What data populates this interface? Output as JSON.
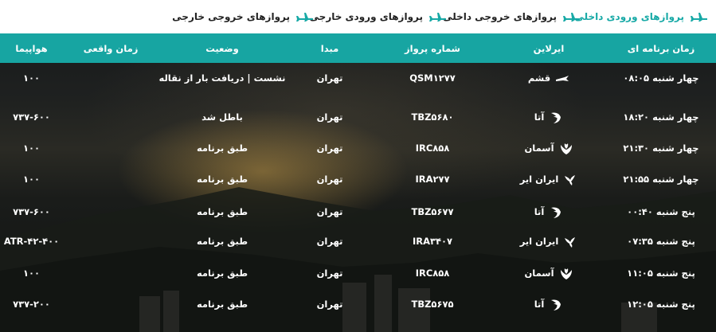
{
  "nav": {
    "items": [
      {
        "label": "پروازهای ورودی داخلی",
        "active": true
      },
      {
        "label": "پروازهای خروجی داخلی",
        "active": false
      },
      {
        "label": "پروازهای ورودی خارجی",
        "active": false
      },
      {
        "label": "پروازهای خروجی خارجی",
        "active": false
      }
    ],
    "active_color": "#17a9a6"
  },
  "table": {
    "headers": {
      "scheduled": "زمان برنامه ای",
      "airline": "ایرلاین",
      "flight": "شماره پرواز",
      "origin": "مبدا",
      "status": "وضعیت",
      "actual": "زمان واقعی",
      "aircraft": "هواپیما"
    },
    "header_color": "#17a5a2",
    "rows": [
      {
        "scheduled": "چهار شنبه ۰۸:۰۵",
        "airline": "قشم",
        "airline_icon": "qeshm-air-logo-icon",
        "flight": "QSM۱۲۷۷",
        "origin": "تهران",
        "status": "نشست | دریافت بار از نقاله",
        "actual": "",
        "aircraft": "۱۰۰"
      },
      {
        "scheduled": "چهار شنبه ۱۸:۲۰",
        "airline": "آتا",
        "airline_icon": "ata-logo-icon",
        "flight": "TBZ۵۶۸۰",
        "origin": "تهران",
        "status": "باطل شد",
        "actual": "",
        "aircraft": "۷۳۷-۶۰۰"
      },
      {
        "scheduled": "چهار شنبه ۲۱:۳۰",
        "airline": "آسمان",
        "airline_icon": "aseman-logo-icon",
        "flight": "IRC۸۵۸",
        "origin": "تهران",
        "status": "طبق برنامه",
        "actual": "",
        "aircraft": "۱۰۰"
      },
      {
        "scheduled": "چهار شنبه ۲۱:۵۵",
        "airline": "ایران ایر",
        "airline_icon": "iran-air-logo-icon",
        "flight": "IRA۲۷۷",
        "origin": "تهران",
        "status": "طبق برنامه",
        "actual": "",
        "aircraft": "۱۰۰"
      },
      {
        "scheduled": "پنج شنبه ۰۰:۴۰",
        "airline": "آتا",
        "airline_icon": "ata-logo-icon",
        "flight": "TBZ۵۶۷۷",
        "origin": "تهران",
        "status": "طبق برنامه",
        "actual": "",
        "aircraft": "۷۳۷-۶۰۰"
      },
      {
        "scheduled": "پنج شنبه ۰۷:۳۵",
        "airline": "ایران ایر",
        "airline_icon": "iran-air-logo-icon",
        "flight": "IRA۳۴۰۷",
        "origin": "تهران",
        "status": "طبق برنامه",
        "actual": "",
        "aircraft": "ATR-۴۲-۴۰۰"
      },
      {
        "scheduled": "پنج شنبه ۱۱:۰۵",
        "airline": "آسمان",
        "airline_icon": "aseman-logo-icon",
        "flight": "IRC۸۵۸",
        "origin": "تهران",
        "status": "طبق برنامه",
        "actual": "",
        "aircraft": "۱۰۰"
      },
      {
        "scheduled": "پنج شنبه ۱۲:۰۵",
        "airline": "آتا",
        "airline_icon": "ata-logo-icon",
        "flight": "TBZ۵۶۷۵",
        "origin": "تهران",
        "status": "طبق برنامه",
        "actual": "",
        "aircraft": "۷۳۷-۲۰۰"
      }
    ]
  }
}
